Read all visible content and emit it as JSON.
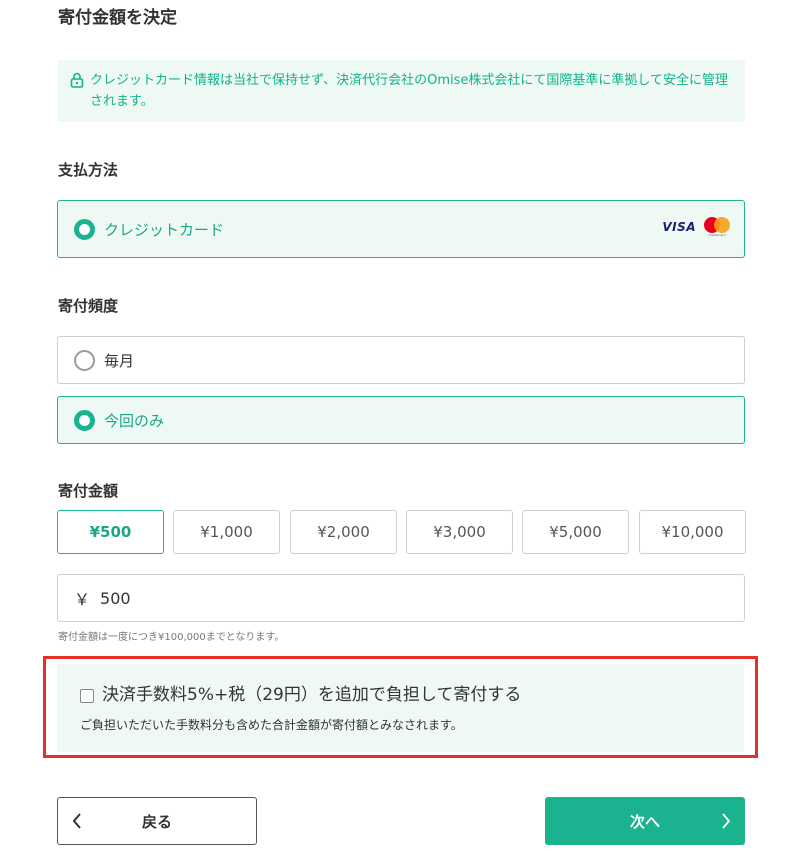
{
  "page_title": "寄付金額を決定",
  "notice": "クレジットカード情報は当社で保持せず、決済代行会社のOmise株式会社にて国際基準に準拠して安全に管理されます。",
  "payment": {
    "label": "支払方法",
    "option": "クレジットカード",
    "brands": {
      "visa": "VISA",
      "mastercard": "mastercard"
    }
  },
  "frequency": {
    "label": "寄付頻度",
    "options": [
      {
        "label": "毎月",
        "selected": false
      },
      {
        "label": "今回のみ",
        "selected": true
      }
    ]
  },
  "amount": {
    "label": "寄付金額",
    "presets": [
      "¥500",
      "¥1,000",
      "¥2,000",
      "¥3,000",
      "¥5,000",
      "¥10,000"
    ],
    "selected_index": 0,
    "currency_symbol": "￥",
    "value": "500",
    "limit_note": "寄付金額は一度につき¥100,000までとなります。"
  },
  "fee": {
    "label": "決済手数料5%+税（29円）を追加で負担して寄付する",
    "sub": "ご負担いただいた手数料分も含めた合計金額が寄付額とみなされます。",
    "checked": false
  },
  "nav": {
    "back": "戻る",
    "next": "次へ"
  },
  "colors": {
    "accent": "#1bb38f",
    "highlight": "#e5302a",
    "tint": "#eef9f4"
  }
}
